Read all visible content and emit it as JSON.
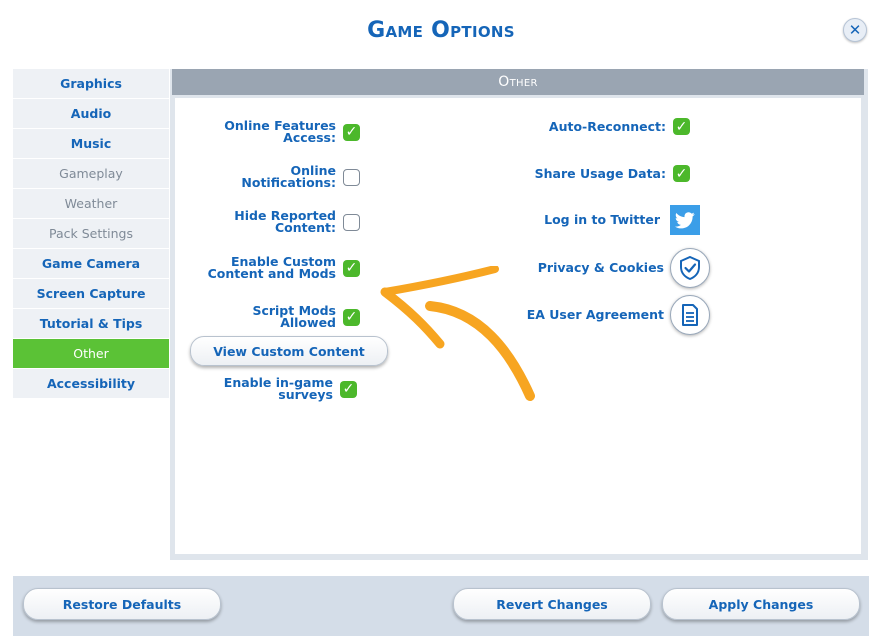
{
  "window": {
    "title": "Game Options"
  },
  "sidebar": {
    "items": [
      {
        "label": "Graphics",
        "state": "normal"
      },
      {
        "label": "Audio",
        "state": "normal"
      },
      {
        "label": "Music",
        "state": "normal"
      },
      {
        "label": "Gameplay",
        "state": "dim"
      },
      {
        "label": "Weather",
        "state": "dim"
      },
      {
        "label": "Pack Settings",
        "state": "dim"
      },
      {
        "label": "Game Camera",
        "state": "normal"
      },
      {
        "label": "Screen Capture",
        "state": "normal"
      },
      {
        "label": "Tutorial & Tips",
        "state": "normal"
      },
      {
        "label": "Other",
        "state": "active"
      },
      {
        "label": "Accessibility",
        "state": "normal"
      }
    ]
  },
  "panel": {
    "header": "Other",
    "left_options": [
      {
        "label_lines": [
          "Online Features",
          "Access:"
        ],
        "checked": true
      },
      {
        "label_lines": [
          "Online Notifications:"
        ],
        "checked": false
      },
      {
        "label_lines": [
          "Hide Reported",
          "Content:"
        ],
        "checked": false
      },
      {
        "label_lines": [
          "Enable Custom",
          "Content and Mods"
        ],
        "checked": true
      },
      {
        "label_lines": [
          "Script Mods Allowed"
        ],
        "checked": true
      },
      {
        "label_lines": [
          "Enable in-game",
          "surveys"
        ],
        "checked": true
      }
    ],
    "view_custom_content_label": "View Custom Content",
    "right_options": [
      {
        "label": "Auto-Reconnect:",
        "checked": true
      },
      {
        "label": "Share Usage Data:",
        "checked": true
      }
    ],
    "twitter_label": "Log in to Twitter",
    "privacy_label": "Privacy & Cookies",
    "agreement_label": "EA User Agreement"
  },
  "footer": {
    "restore_label": "Restore Defaults",
    "revert_label": "Revert Changes",
    "apply_label": "Apply Changes"
  },
  "colors": {
    "accent": "#1565b8",
    "active_tab": "#5bc236",
    "check": "#4cb82b",
    "annotation_arrow": "#f7a521"
  },
  "icons": [
    "close-icon",
    "checkmark-icon",
    "twitter-icon",
    "shield-check-icon",
    "document-icon"
  ]
}
